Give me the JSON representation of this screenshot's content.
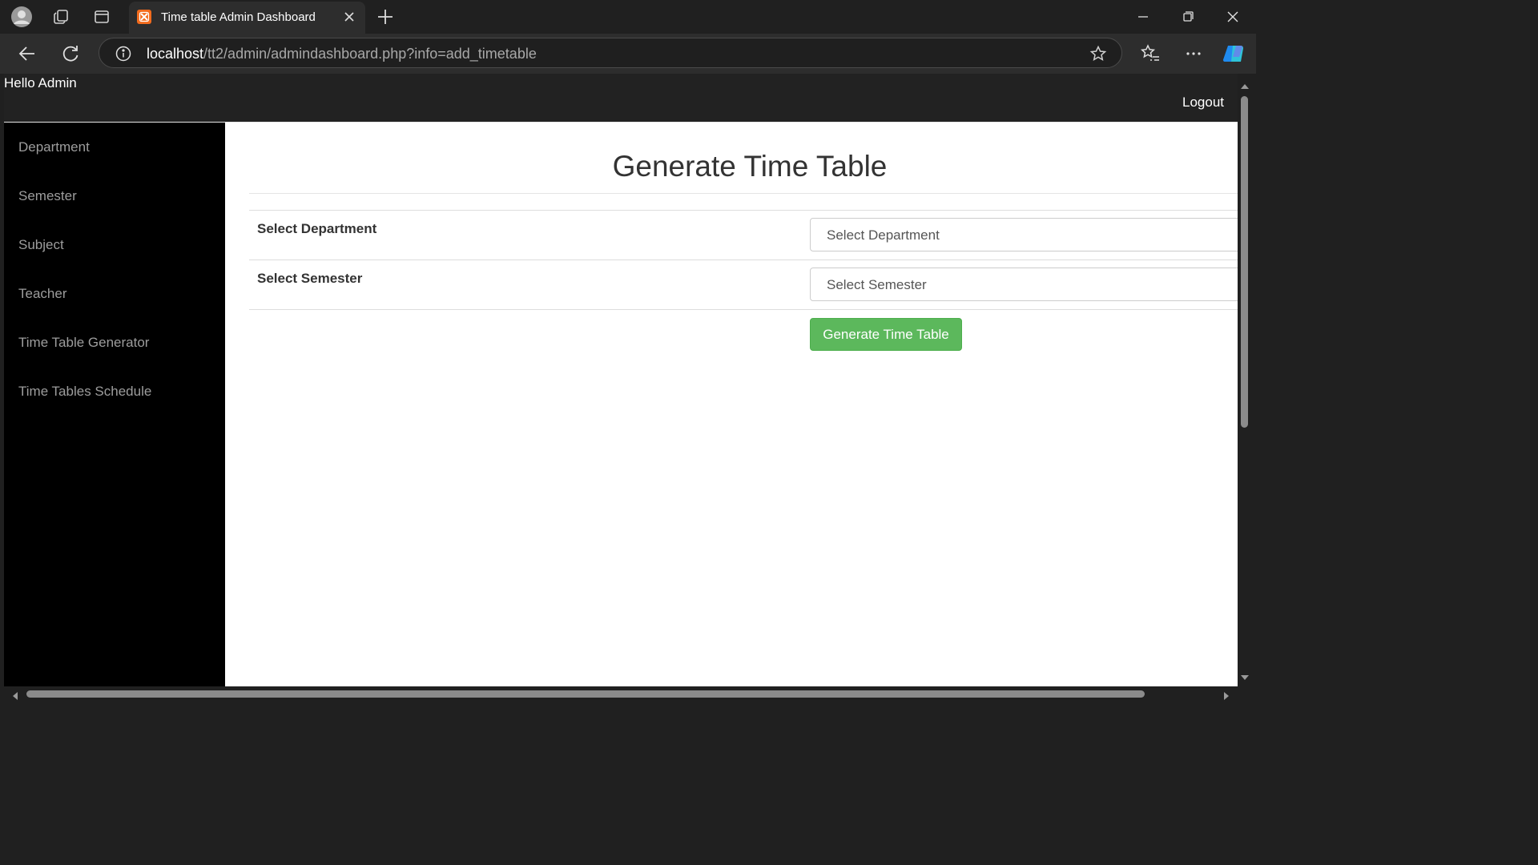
{
  "browser": {
    "tab_title": "Time table Admin Dashboard",
    "favicon_text": "✕",
    "url_host": "localhost",
    "url_path": "/tt2/admin/admindashboard.php?info=add_timetable",
    "colors": {
      "chrome_bg": "#202020",
      "tab_bg": "#2d2d2d",
      "favicon": "#f26b1d"
    }
  },
  "header": {
    "greeting": "Hello Admin",
    "logout_label": "Logout"
  },
  "sidebar": {
    "items": [
      {
        "label": "Department"
      },
      {
        "label": "Semester"
      },
      {
        "label": "Subject"
      },
      {
        "label": "Teacher"
      },
      {
        "label": "Time Table Generator"
      },
      {
        "label": "Time Tables Schedule"
      }
    ]
  },
  "main": {
    "title": "Generate Time Table",
    "form": {
      "department_label": "Select Department",
      "department_value": "Select Department",
      "semester_label": "Select Semester",
      "semester_value": "Select Semester",
      "submit_label": "Generate Time Table"
    },
    "colors": {
      "button": "#5cb85c",
      "sidebar_bg": "#000000",
      "topnav_bg": "#222222"
    }
  }
}
